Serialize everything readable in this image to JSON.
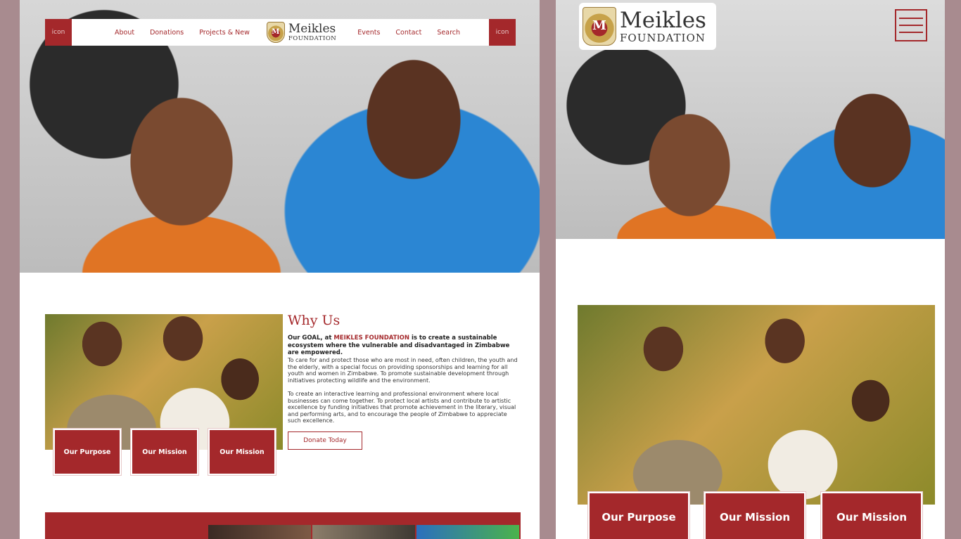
{
  "desktop": {
    "nav": {
      "left_icon_alt": "icon",
      "right_icon_alt": "icon",
      "left_links": [
        "About",
        "Donations",
        "Projects & New"
      ],
      "right_links": [
        "Events",
        "Contact",
        "Search"
      ]
    },
    "logo": {
      "title": "Meikles",
      "subtitle": "FOUNDATION"
    },
    "why": {
      "title": "Why Us",
      "goal_prefix": "Our GOAL, at ",
      "goal_brand": "MEIKLES FOUNDATION",
      "goal_suffix": " is to create a sustainable ecosystem where the vulnerable and disadvantaged in Zimbabwe are empowered.",
      "paragraph_1": "To care for and protect those who are most in need, often children, the youth and the elderly, with a special focus on providing sponsorships and learning for all youth and women in Zimbabwe. To promote sustainable development through initiatives protecting wildlife and the environment.",
      "paragraph_2": "To create an interactive learning and professional environment where local businesses can come together. To protect local artists and contribute to artistic excellence by funding initiatives that promote achievement in the literary, visual and performing arts, and to encourage the people of Zimbabwe to appreciate such excellence.",
      "donate_label": "Donate Today"
    },
    "buttons": [
      "Our Purpose",
      "Our Mission",
      "Our Mission"
    ]
  },
  "mobile": {
    "logo": {
      "title": "Meikles",
      "subtitle": "FOUNDATION"
    },
    "buttons": [
      "Our Purpose",
      "Our Mission",
      "Our Mission"
    ]
  },
  "colors": {
    "brand_red": "#a4282b",
    "backdrop": "#a88b8f"
  },
  "icons": [
    "crest-logo-icon",
    "hamburger-menu-icon",
    "broken-image-icon"
  ]
}
